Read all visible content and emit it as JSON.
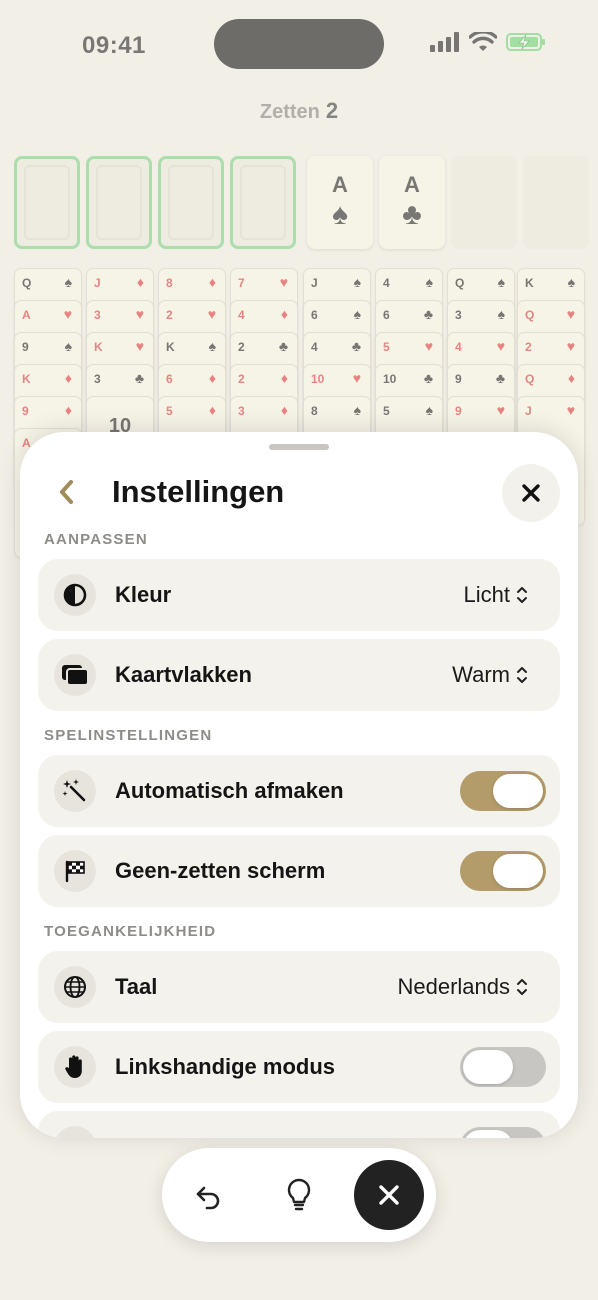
{
  "status_bar": {
    "time": "09:41"
  },
  "game": {
    "moves_label": "Zetten",
    "moves_count": "2",
    "foundations": [
      {
        "rank": "A",
        "suit": "♠"
      },
      {
        "rank": "A",
        "suit": "♣"
      }
    ],
    "tableau": [
      [
        "Q ♠",
        "A ♥",
        "9 ♠",
        "K ♦",
        "9 ♦",
        "A ♥"
      ],
      [
        "J ♦",
        "3 ♥",
        "K ♥",
        "3 ♣",
        "10"
      ],
      [
        "8 ♦",
        "2 ♥",
        "K ♠",
        "6 ♦",
        "5 ♦"
      ],
      [
        "7 ♥",
        "4 ♦",
        "2 ♣",
        "2 ♦",
        "3 ♦"
      ],
      [
        "J ♠",
        "6 ♠",
        "4 ♣",
        "10 ♥",
        "8 ♠"
      ],
      [
        "4 ♠",
        "6 ♣",
        "5 ♥",
        "10 ♣",
        "5 ♠"
      ],
      [
        "Q ♠",
        "3 ♠",
        "4 ♥",
        "9 ♣",
        "9 ♥"
      ],
      [
        "K ♠",
        "Q ♥",
        "2 ♥",
        "Q ♦",
        "J ♥"
      ]
    ]
  },
  "settings": {
    "title": "Instellingen",
    "sections": {
      "customize": "AANPASSEN",
      "game": "SPELINSTELLINGEN",
      "accessibility": "TOEGANKELIJKHEID"
    },
    "rows": {
      "color": {
        "label": "Kleur",
        "value": "Licht",
        "icon": "contrast-icon"
      },
      "card_faces": {
        "label": "Kaartvlakken",
        "value": "Warm",
        "icon": "cards-icon"
      },
      "auto_finish": {
        "label": "Automatisch afmaken",
        "on": true,
        "icon": "magic-wand-icon"
      },
      "no_moves_screen": {
        "label": "Geen-zetten scherm",
        "on": true,
        "icon": "checkered-flag-icon"
      },
      "language": {
        "label": "Taal",
        "value": "Nederlands",
        "icon": "globe-icon"
      },
      "left_handed": {
        "label": "Linkshandige modus",
        "on": false,
        "icon": "hand-icon"
      }
    }
  },
  "colors": {
    "accent": "#b39c6a",
    "success": "#6fcf78",
    "red_suit": "#dc2d2d"
  }
}
